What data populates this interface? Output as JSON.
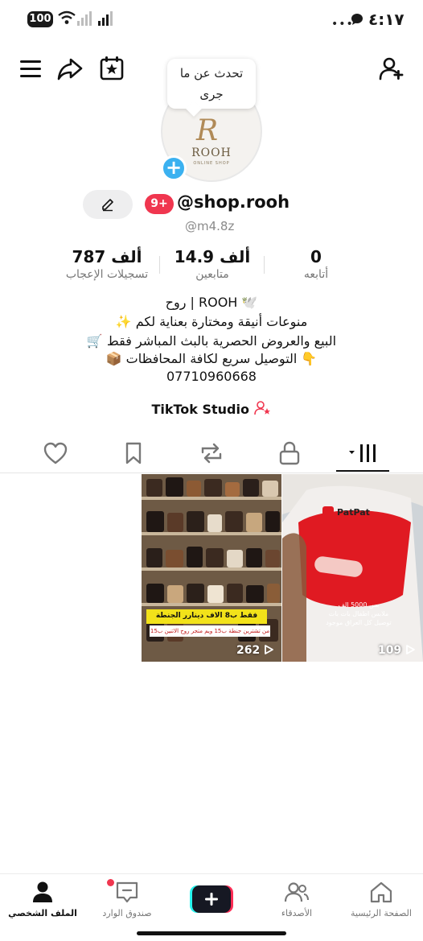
{
  "status_bar": {
    "battery": "100",
    "time": "٤:١٧"
  },
  "header": {
    "talk_tooltip_line1": "تحدث عن ما",
    "talk_tooltip_line2": "جرى"
  },
  "avatar": {
    "logo_mark": "R",
    "logo_text": "ROOH",
    "logo_subtext": "ONLINE SHOP"
  },
  "profile": {
    "notification_badge": "9+",
    "username": "@shop.rooh",
    "handle": "@m4.8z"
  },
  "stats": [
    {
      "value": "0",
      "label": "أتابعه"
    },
    {
      "value": "14.9 ألف",
      "label": "متابعين"
    },
    {
      "value": "787 ألف",
      "label": "تسجيلات الإعجاب"
    }
  ],
  "bio": [
    "روح | ROOH 🕊️",
    "✨ منوعات أنيقة ومختارة بعناية لكم",
    "🛒 البيع والعروض الحصرية بالبث المباشر فقط",
    "📦 التوصيل سريع لكافة المحافظات 👇",
    "07710960668"
  ],
  "studio_label": "TikTok Studio",
  "videos": [
    {
      "count": "109",
      "brand": "PatPat",
      "caption_lines": [
        "بس 5000 الف",
        "ملابس اطفال بات بات",
        "توصيل كل العراق موجود"
      ]
    },
    {
      "count": "262",
      "caption_lines": [
        "فقط ب8 الاف دينارر الجنطة",
        "من تشترين جنطة ب15 ويم متجر روح الاثنين ب15"
      ]
    }
  ],
  "bottom_nav": [
    {
      "label": "الصفحة الرئيسية"
    },
    {
      "label": "الأصدقاء"
    },
    {
      "label": "صندوق الوارد"
    },
    {
      "label": "الملف الشخصي"
    }
  ],
  "colors": {
    "accent_red": "#f0364f",
    "accent_blue": "#3bb1f0",
    "create_cyan": "#25f4ee",
    "create_pink": "#fe2c55"
  }
}
